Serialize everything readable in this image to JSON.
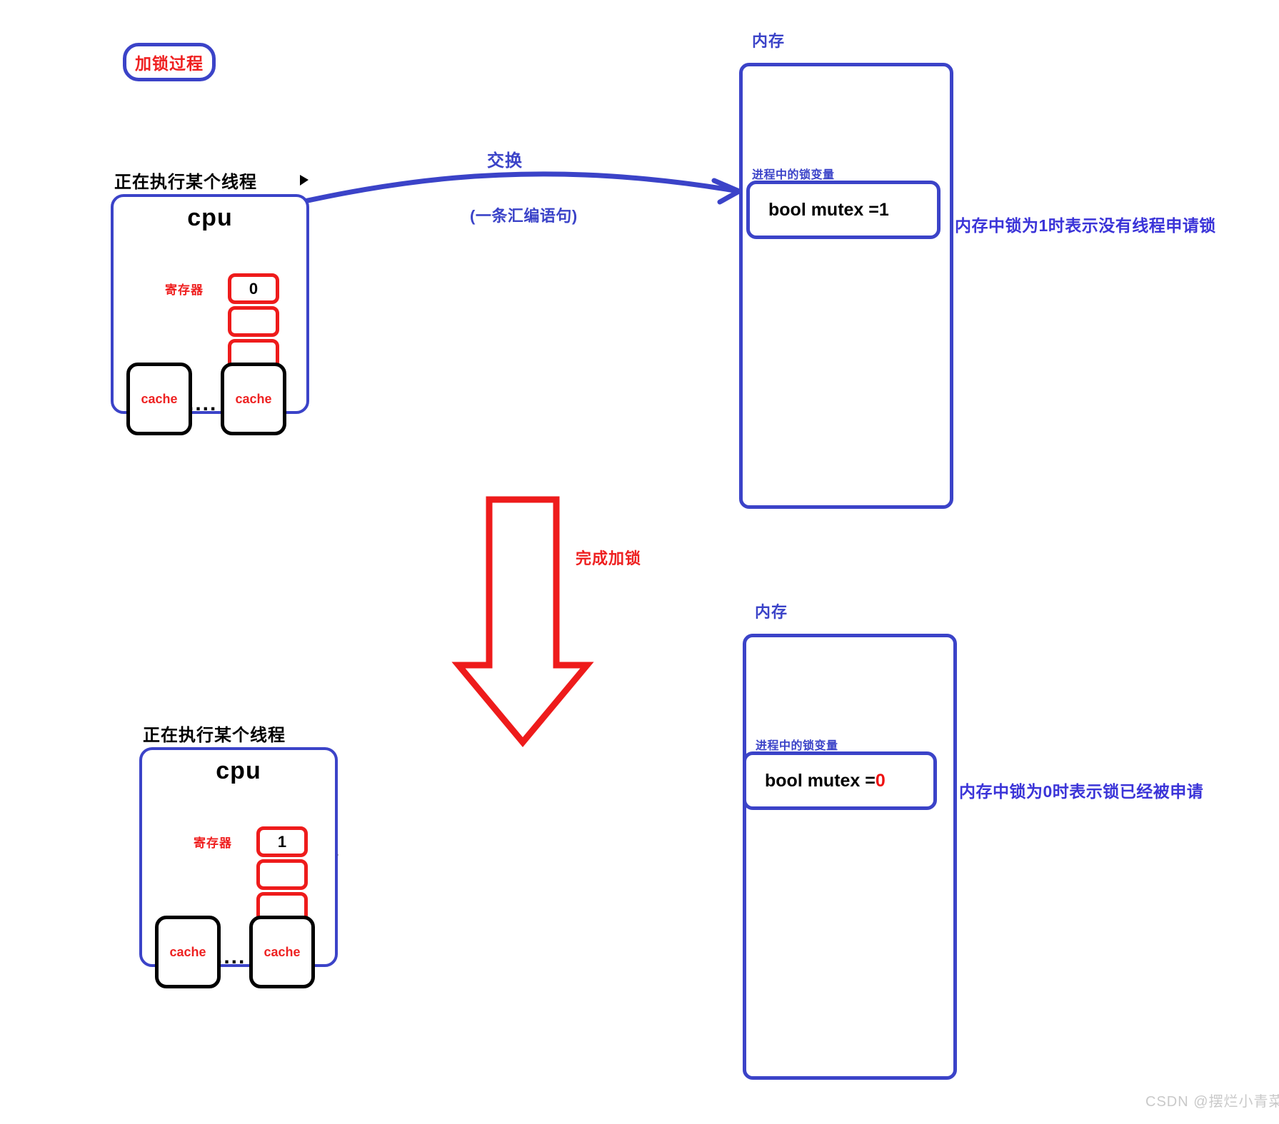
{
  "page": {
    "title_badge": "加锁过程",
    "watermark": "CSDN @摆烂小青菜",
    "colors": {
      "blue": "#3b43c8",
      "red": "#ee1b1b",
      "black": "#000000",
      "note_blue": "#3b34d8",
      "watermark_gray": "#c9c9c9"
    }
  },
  "transition": {
    "curve_label_top": "交换",
    "curve_label_bottom": "(一条汇编语句)",
    "down_arrow_label": "完成加锁"
  },
  "top": {
    "cpu": {
      "thread_caption": "正在执行某个线程",
      "cpu_label": "cpu",
      "register_label": "寄存器",
      "registers": [
        "0",
        "",
        ""
      ],
      "cache_left": "cache",
      "cache_right": "cache",
      "dots": "...."
    },
    "memory": {
      "caption": "内存",
      "variable_label": "进程中的锁变量",
      "mutex_prefix": "bool mutex = ",
      "mutex_value": "1",
      "side_note": "内存中锁为1时表示没有线程申请锁"
    }
  },
  "bottom": {
    "cpu": {
      "thread_caption": "正在执行某个线程",
      "cpu_label": "cpu",
      "register_label": "寄存器",
      "registers": [
        "1",
        "",
        ""
      ],
      "cache_left": "cache",
      "cache_right": "cache",
      "dots": "...."
    },
    "memory": {
      "caption": "内存",
      "variable_label": "进程中的锁变量",
      "mutex_prefix": "bool mutex = ",
      "mutex_value": "0",
      "side_note": "内存中锁为0时表示锁已经被申请"
    }
  }
}
